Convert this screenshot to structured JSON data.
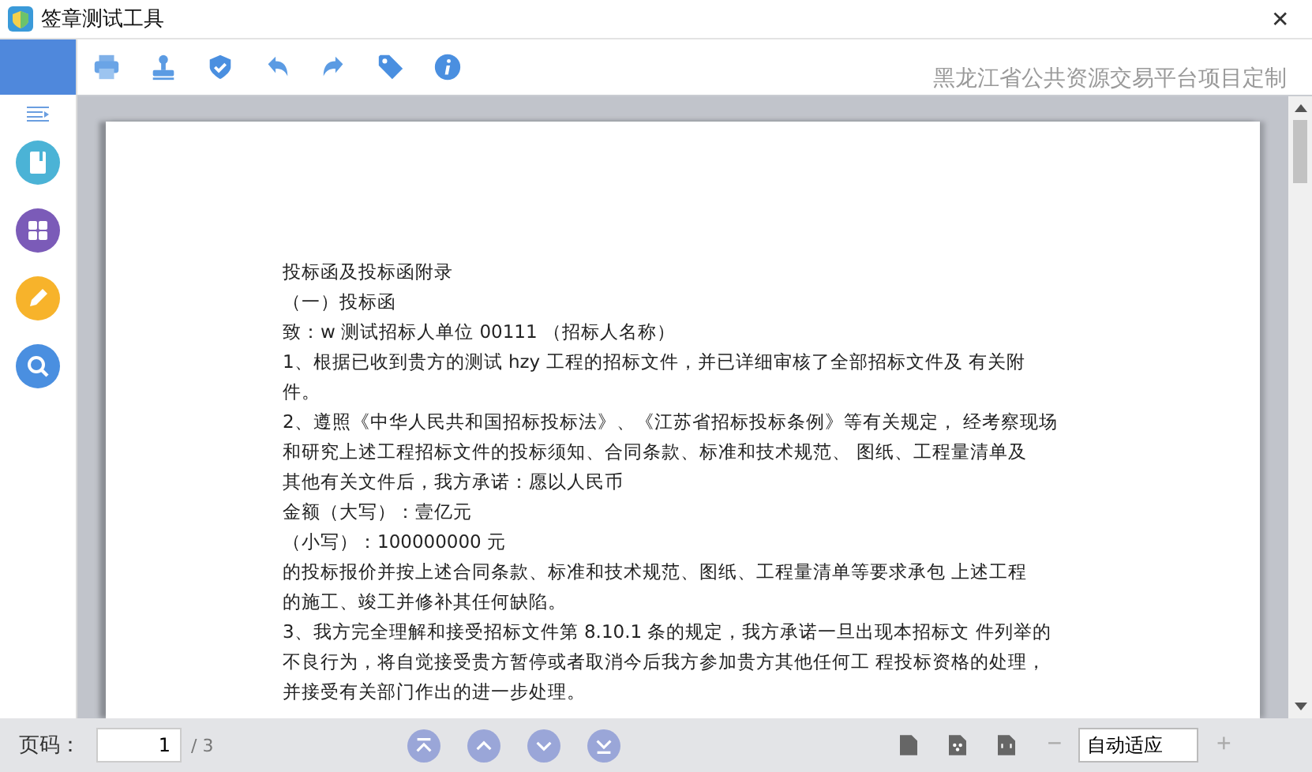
{
  "window": {
    "title": "签章测试工具",
    "close": "✕"
  },
  "toolbar": {
    "caption": "黑龙江省公共资源交易平台项目定制"
  },
  "document": {
    "lines": [
      "投标函及投标函附录",
      "（一）投标函",
      "致：w 测试招标人单位 00111 （招标人名称）",
      "1、根据已收到贵方的测试 hzy 工程的招标文件，并已详细审核了全部招标文件及 有关附",
      "件。",
      "2、遵照《中华人民共和国招标投标法》、《江苏省招标投标条例》等有关规定， 经考察现场",
      "和研究上述工程招标文件的投标须知、合同条款、标准和技术规范、 图纸、工程量清单及",
      "其他有关文件后，我方承诺：愿以人民币",
      "金额（大写）：壹亿元",
      "（小写）：100000000 元",
      "的投标报价并按上述合同条款、标准和技术规范、图纸、工程量清单等要求承包 上述工程",
      "的施工、竣工并修补其任何缺陷。",
      "3、我方完全理解和接受招标文件第 8.10.1 条的规定，我方承诺一旦出现本招标文 件列举的",
      "不良行为，将自觉接受贵方暂停或者取消今后我方参加贵方其他任何工 程投标资格的处理，",
      "并接受有关部门作出的进一步处理。"
    ]
  },
  "status_bar": {
    "page_label": "页码：",
    "page_value": "1",
    "page_total": "/ 3",
    "zoom_out": "−",
    "zoom_value": "自动适应",
    "zoom_in": "+"
  }
}
